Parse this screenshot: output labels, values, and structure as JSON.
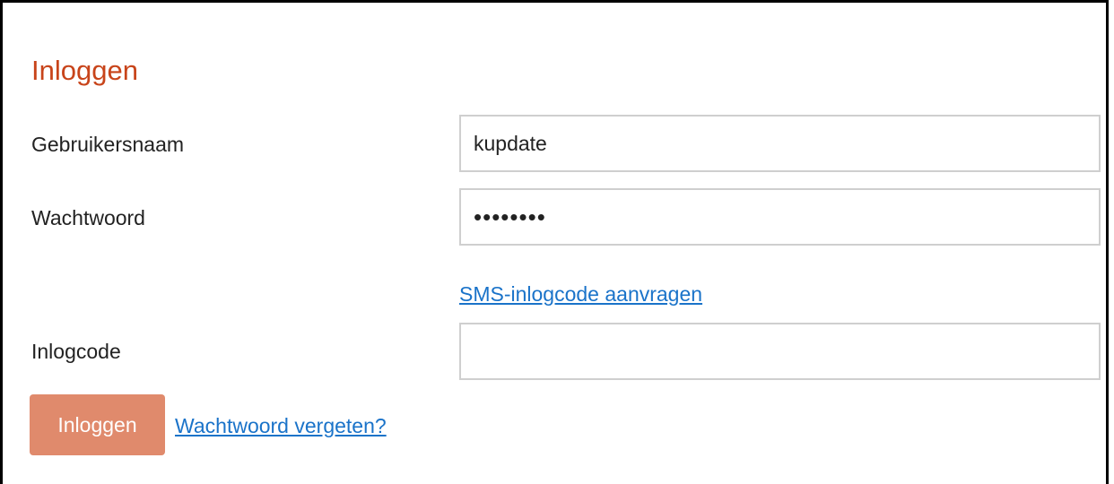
{
  "form": {
    "title": "Inloggen",
    "username_label": "Gebruikersnaam",
    "username_value": "kupdate",
    "password_label": "Wachtwoord",
    "password_value": "••••••••",
    "sms_link": "SMS-inlogcode aanvragen",
    "code_label": "Inlogcode",
    "code_value": "",
    "login_button": "Inloggen",
    "forgot_link": "Wachtwoord vergeten?"
  },
  "colors": {
    "title": "#c8441a",
    "button": "#e08a6c",
    "link": "#1a73c9",
    "input_border": "#cfcfcf"
  }
}
